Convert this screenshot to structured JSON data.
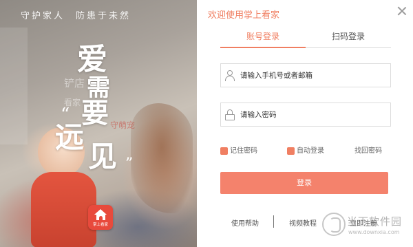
{
  "promo": {
    "slogan_top": "守护家人　防患于未然",
    "slogan_line1": "爱",
    "slogan_line2": "需",
    "slogan_line3": "要",
    "slogan_line4": "远",
    "slogan_line5": "见",
    "quote_open": "“",
    "quote_close": "”",
    "faded_1": "铲店",
    "faded_2": "看家",
    "faded_3": "守萌宠",
    "logo_text": "掌上看家"
  },
  "login": {
    "title": "欢迎使用掌上看家",
    "tabs": [
      {
        "label": "账号登录",
        "active": true
      },
      {
        "label": "扫码登录",
        "active": false
      }
    ],
    "username": {
      "value": "",
      "placeholder": "请输入手机号或者邮箱"
    },
    "password": {
      "value": "",
      "placeholder": "请输入密码"
    },
    "remember_label": "记住密码",
    "auto_login_label": "自动登录",
    "forgot_label": "找回密码",
    "login_button": "登录",
    "footer": {
      "help": "使用帮助",
      "video": "视频教程",
      "register": "立即注册"
    }
  },
  "watermark": {
    "text": "当下软件园",
    "url": "www.downxia.com"
  },
  "colors": {
    "accent": "#f07f62",
    "button": "#f4826c",
    "logo": "#e84a3c"
  },
  "icons": [
    "close-icon",
    "user-icon",
    "lock-icon",
    "app-logo-icon"
  ]
}
